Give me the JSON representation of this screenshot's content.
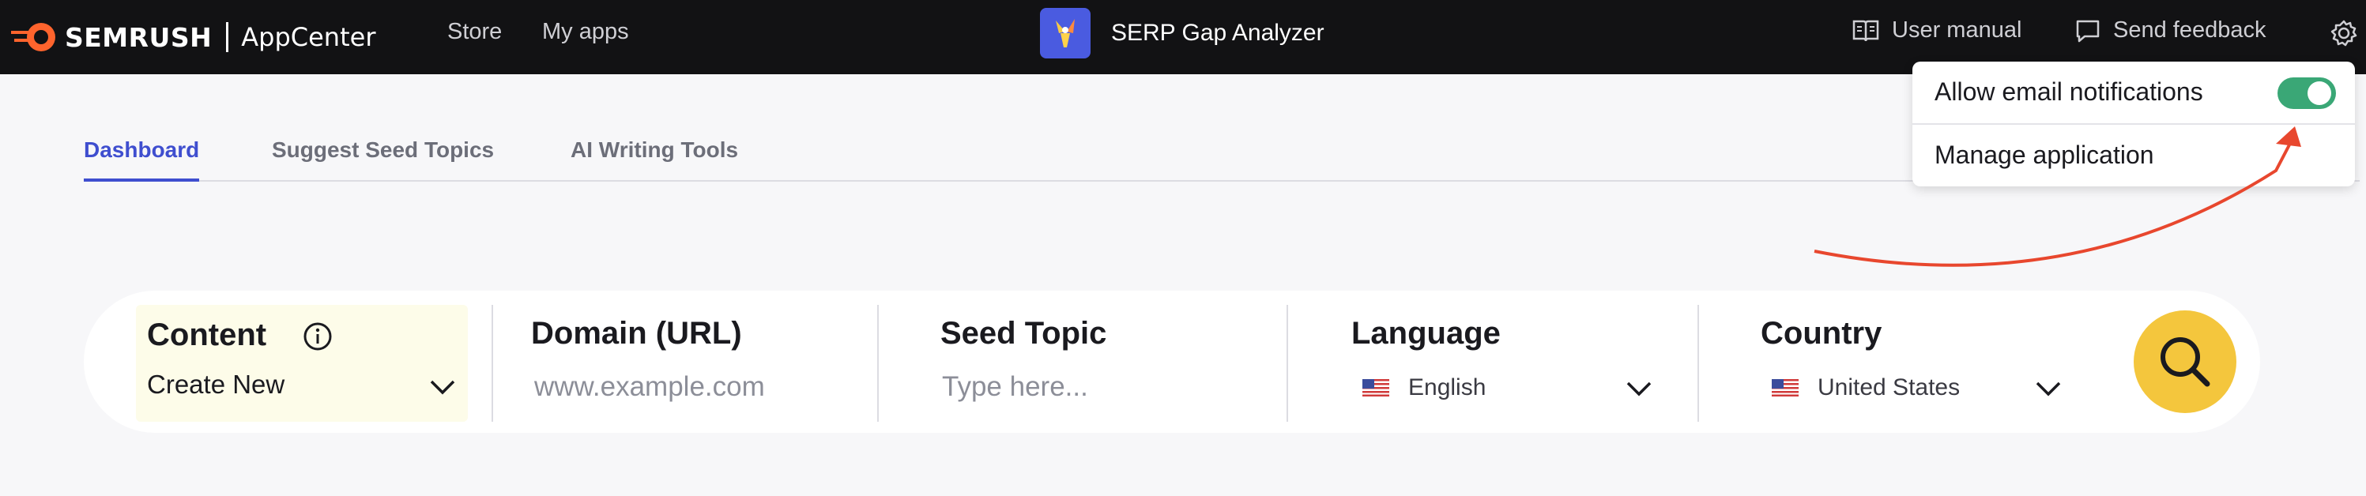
{
  "brand": {
    "name": "SEMRUSH",
    "product": "AppCenter"
  },
  "nav": {
    "store": "Store",
    "my_apps": "My apps"
  },
  "app": {
    "title": "SERP Gap Analyzer"
  },
  "top_actions": {
    "user_manual": "User manual",
    "send_feedback": "Send feedback"
  },
  "menu": {
    "email_notifications": "Allow email notifications",
    "email_notifications_on": true,
    "manage": "Manage application"
  },
  "tabs": [
    {
      "label": "Dashboard",
      "active": true
    },
    {
      "label": "Suggest Seed Topics",
      "active": false
    },
    {
      "label": "AI Writing Tools",
      "active": false
    }
  ],
  "search": {
    "content": {
      "label": "Content",
      "value": "Create New"
    },
    "domain": {
      "label": "Domain (URL)",
      "placeholder": "www.example.com"
    },
    "seed": {
      "label": "Seed Topic",
      "placeholder": "Type here..."
    },
    "language": {
      "label": "Language",
      "value": "English"
    },
    "country": {
      "label": "Country",
      "value": "United States"
    }
  },
  "colors": {
    "accent": "#3f4ecf",
    "brand_orange": "#ff642d",
    "toggle_on": "#3aa776",
    "search_button": "#f4c63d",
    "annotation_arrow": "#e8472e"
  }
}
